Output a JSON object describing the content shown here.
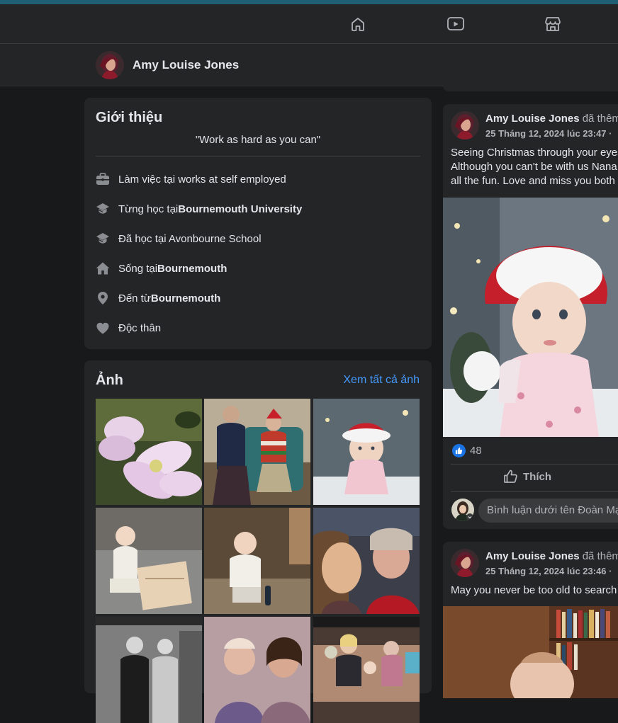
{
  "nav": {
    "icons": [
      "home-icon",
      "watch-icon",
      "marketplace-icon"
    ]
  },
  "profile": {
    "name": "Amy Louise Jones"
  },
  "intro": {
    "title": "Giới thiệu",
    "bio": "\"Work as hard as you can\"",
    "items": [
      {
        "icon": "briefcase-icon",
        "prefix": "Làm việc tại works at self employed",
        "bold": ""
      },
      {
        "icon": "graduation-cap-icon",
        "prefix": "Từng học tại ",
        "bold": "Bournemouth University"
      },
      {
        "icon": "graduation-cap-icon",
        "prefix": "Đã học tại Avonbourne School",
        "bold": ""
      },
      {
        "icon": "house-icon",
        "prefix": "Sống tại ",
        "bold": "Bournemouth"
      },
      {
        "icon": "location-pin-icon",
        "prefix": "Đến từ ",
        "bold": "Bournemouth"
      },
      {
        "icon": "heart-icon",
        "prefix": "Độc thân",
        "bold": ""
      }
    ]
  },
  "photos": {
    "title": "Ảnh",
    "see_all": "Xem tất cả ảnh"
  },
  "posts": [
    {
      "author": "Amy Louise Jones",
      "action": " đã thêm",
      "time": "25 Tháng 12, 2024 lúc 23:47 ·",
      "lines": [
        "Seeing Christmas through your eyes",
        "Although you can't be with us Nana",
        "all the fun. Love and miss you both"
      ],
      "reaction_count": "48",
      "like_label": "Thích",
      "comment_placeholder": "Bình luận dưới tên Đoàn Mạnh"
    },
    {
      "author": "Amy Louise Jones",
      "action": " đã thêm",
      "time": "25 Tháng 12, 2024 lúc 23:46 ·",
      "lines": [
        "May you never be too old to search"
      ]
    }
  ],
  "colors": {
    "background": "#18191a",
    "card": "#242526",
    "link": "#4599ff",
    "like": "#1b74e4"
  }
}
